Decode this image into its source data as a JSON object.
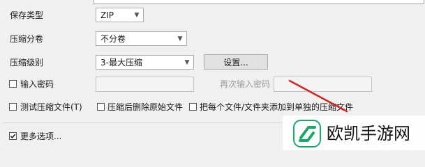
{
  "format": {
    "label": "保存类型",
    "value": "ZIP"
  },
  "split": {
    "label": "压缩分卷",
    "value": "不分卷"
  },
  "level": {
    "label": "压缩级别",
    "value": "3-最大压缩",
    "settings_button": "设置..."
  },
  "password": {
    "checkbox_label": "输入密码",
    "confirm_label": "再次输入密码"
  },
  "options": {
    "test": "测试压缩文件(T)",
    "delete_after": "压缩后删除原始文件",
    "separate": "把每个文件/文件夹添加到单独的压缩文件"
  },
  "more_options": "更多选项...",
  "watermark": {
    "text": "欧凯手游网",
    "accent": "#1aa86a",
    "arrow_color": "#cc2a2a"
  }
}
